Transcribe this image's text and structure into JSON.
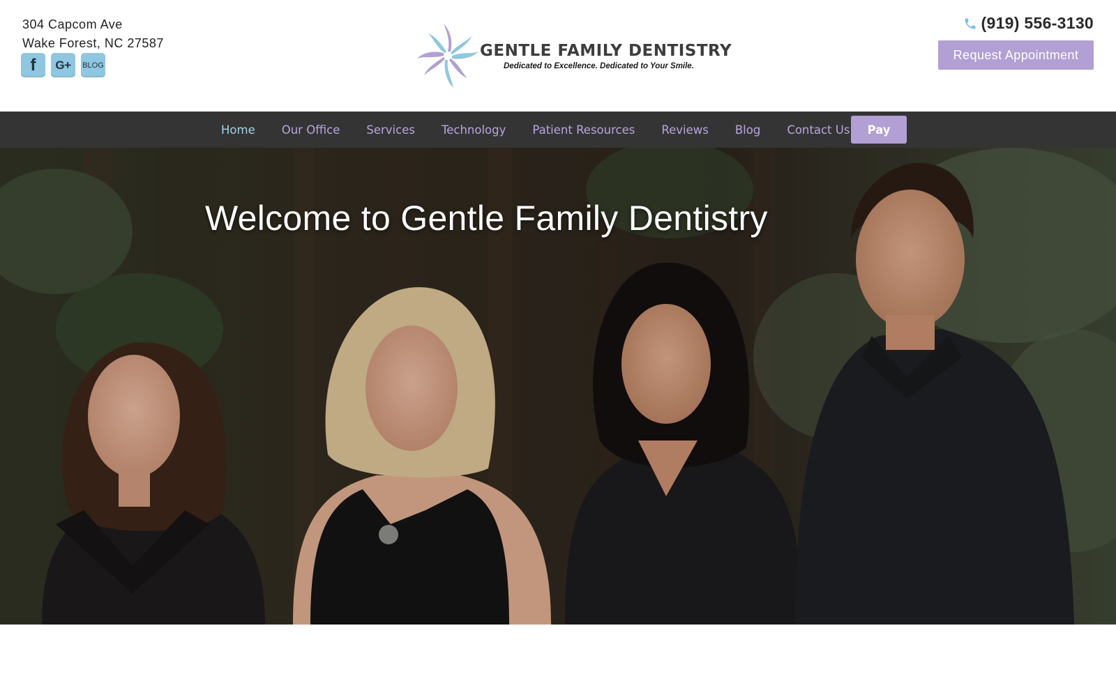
{
  "header": {
    "address_line1": "304 Capcom Ave",
    "address_line2": "Wake Forest, NC 27587",
    "socials": [
      {
        "label": "f",
        "icon": "facebook-icon"
      },
      {
        "label": "G+",
        "icon": "google-plus-icon"
      },
      {
        "label": "BLOG",
        "icon": "blog-icon"
      }
    ],
    "logo_title": "GENTLE FAMILY DENTISTRY",
    "logo_tagline": "Dedicated to Excellence. Dedicated to Your Smile.",
    "phone": "(919) 556-3130",
    "phone_icon": "phone-icon",
    "request_button": "Request Appointment"
  },
  "nav": {
    "items": [
      {
        "label": "Home",
        "active": true
      },
      {
        "label": "Our Office"
      },
      {
        "label": "Services"
      },
      {
        "label": "Technology"
      },
      {
        "label": "Patient Resources"
      },
      {
        "label": "Reviews"
      },
      {
        "label": "Blog"
      },
      {
        "label": "Contact Us"
      }
    ],
    "pay_label": "Pay"
  },
  "hero": {
    "title": "Welcome to Gentle Family Dentistry"
  },
  "colors": {
    "accent_purple": "#b29fd3",
    "nav_link": "#b7a6de",
    "nav_active": "#9fd3ea",
    "nav_bg": "#343434",
    "social_blue": "#8fc6e0"
  }
}
